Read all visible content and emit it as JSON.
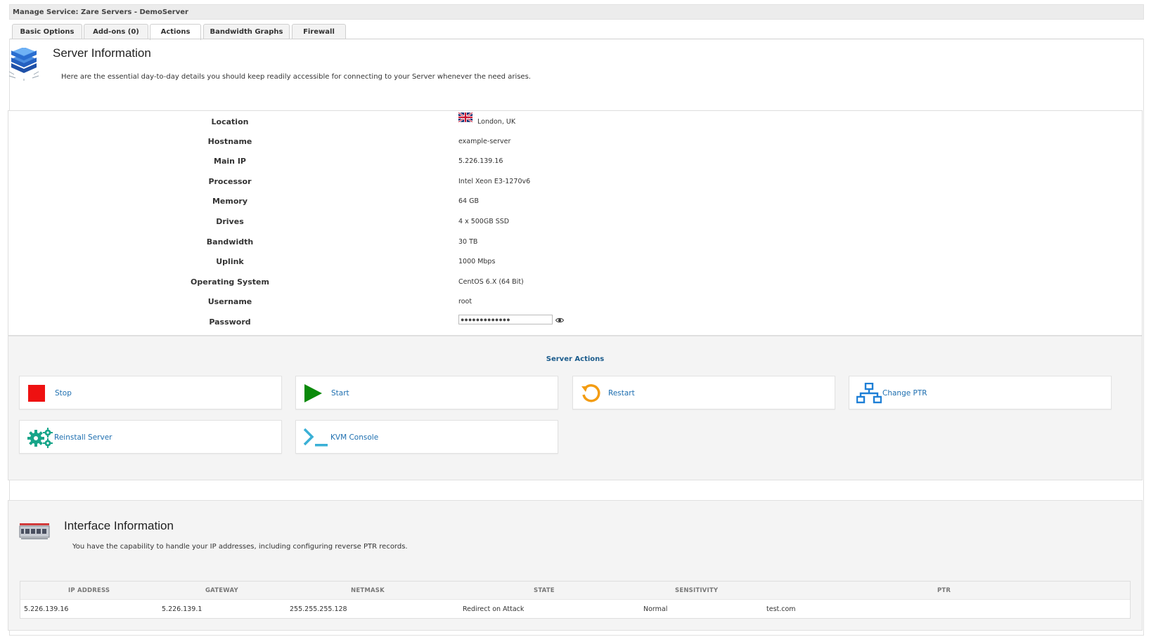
{
  "window": {
    "title": "Manage Service: Zare Servers - DemoServer"
  },
  "tabs": [
    {
      "label": "Basic Options"
    },
    {
      "label": "Add-ons (0)"
    },
    {
      "label": "Actions"
    },
    {
      "label": "Bandwidth Graphs"
    },
    {
      "label": "Firewall"
    }
  ],
  "server_info": {
    "title": "Server Information",
    "description": "Here are the essential day-to-day details you should keep readily accessible for connecting to your Server whenever the need arises.",
    "icon": "server-stack-icon",
    "rows": [
      {
        "label": "Location",
        "value": "London, UK",
        "flag": "uk-flag-icon"
      },
      {
        "label": "Hostname",
        "value": "example-server"
      },
      {
        "label": "Main IP",
        "value": "5.226.139.16"
      },
      {
        "label": "Processor",
        "value": "Intel Xeon E3-1270v6"
      },
      {
        "label": "Memory",
        "value": "64 GB"
      },
      {
        "label": "Drives",
        "value": "4 x 500GB SSD"
      },
      {
        "label": "Bandwidth",
        "value": "30 TB"
      },
      {
        "label": "Uplink",
        "value": "1000 Mbps"
      },
      {
        "label": "Operating System",
        "value": "CentOS 6.X (64 Bit)"
      },
      {
        "label": "Username",
        "value": "root"
      },
      {
        "label": "Password",
        "value": "●●●●●●●●●●●●●"
      }
    ]
  },
  "server_actions": {
    "title": "Server Actions",
    "items": [
      {
        "label": "Stop",
        "icon": "stop-icon",
        "color": "#ee1111"
      },
      {
        "label": "Start",
        "icon": "play-icon",
        "color": "#0a8a0a"
      },
      {
        "label": "Restart",
        "icon": "restart-icon",
        "color": "#f39c12"
      },
      {
        "label": "Change PTR",
        "icon": "network-icon",
        "color": "#1e7fd6"
      },
      {
        "label": "Reinstall Server",
        "icon": "gears-icon",
        "color": "#17a589"
      },
      {
        "label": "KVM Console",
        "icon": "terminal-icon",
        "color": "#3ab0d6"
      }
    ]
  },
  "interface_info": {
    "title": "Interface Information",
    "description": "You have the capability to handle your IP addresses, including configuring reverse PTR records.",
    "icon": "network-switch-icon",
    "columns": [
      "IP ADDRESS",
      "GATEWAY",
      "NETMASK",
      "STATE",
      "SENSITIVITY",
      "PTR"
    ],
    "rows": [
      {
        "ip": "5.226.139.16",
        "gateway": "5.226.139.1",
        "netmask": "255.255.255.128",
        "state": "Redirect on Attack",
        "sensitivity": "Normal",
        "ptr": "test.com"
      }
    ]
  },
  "colors": {
    "link": "#1e6fb0",
    "section_title": "#1a5b8c"
  }
}
